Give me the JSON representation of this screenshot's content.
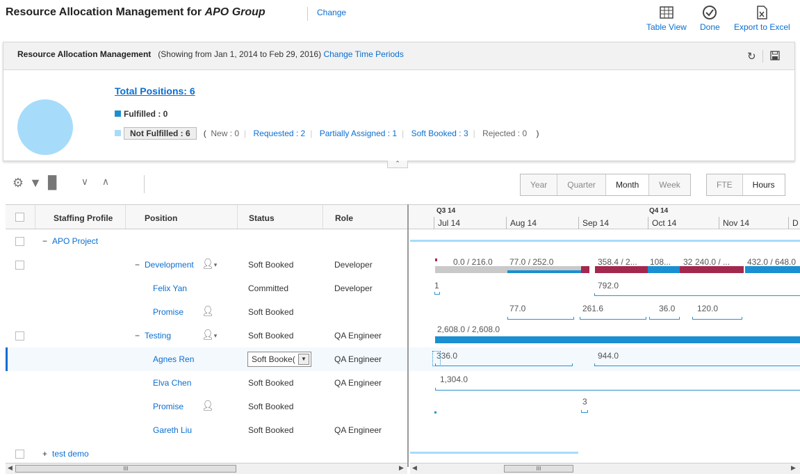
{
  "header": {
    "title_prefix": "Resource Allocation Management for",
    "group": "APO Group",
    "change": "Change",
    "table_view": "Table View",
    "done": "Done",
    "export": "Export to Excel"
  },
  "panel": {
    "title": "Resource Allocation Management",
    "showing": "(Showing from Jan 1, 2014 to Feb 29, 2016)",
    "change_periods": "Change Time Periods",
    "total_positions": "Total Positions:  6",
    "fulfilled": "Fulfilled : 0",
    "not_fulfilled": "Not Fulfilled : 6",
    "open_paren": "(",
    "new": "New : 0",
    "requested": "Requested : 2",
    "partially": "Partially Assigned : 1",
    "soft_booked": "Soft Booked : 3",
    "rejected": "Rejected : 0",
    "close_paren": ")",
    "colors": {
      "fulfilled": "#1a8fd1",
      "not_fulfilled": "#a6dcfa"
    }
  },
  "timescale": {
    "options": [
      "Year",
      "Quarter",
      "Month",
      "Week"
    ],
    "selected": "Month"
  },
  "unit": {
    "options": [
      "FTE",
      "Hours"
    ],
    "selected": "Hours"
  },
  "columns": {
    "profile": "Staffing Profile",
    "position": "Position",
    "status": "Status",
    "role": "Role"
  },
  "rows": {
    "apo": {
      "expander": "−",
      "label": "APO Project"
    },
    "dev": {
      "expander": "−",
      "position": "Development",
      "status": "Soft Booked",
      "role": "Developer"
    },
    "felix": {
      "position": "Felix Yan",
      "status": "Committed",
      "role": "Developer"
    },
    "promise1": {
      "position": "Promise",
      "status": "Soft Booked",
      "role": ""
    },
    "testing": {
      "expander": "−",
      "position": "Testing",
      "status": "Soft Booked",
      "role": "QA Engineer"
    },
    "agnes": {
      "position": "Agnes Ren",
      "status": "Soft Booke(",
      "role": "QA Engineer"
    },
    "elva": {
      "position": "Elva Chen",
      "status": "Soft Booked",
      "role": "QA Engineer"
    },
    "promise2": {
      "position": "Promise",
      "status": "Soft Booked",
      "role": ""
    },
    "gareth": {
      "position": "Gareth Liu",
      "status": "Soft Booked",
      "role": "QA Engineer"
    },
    "demo": {
      "expander": "+",
      "label": "test demo"
    }
  },
  "gantt": {
    "quarters": [
      "Q3 14",
      "Q4 14"
    ],
    "months": [
      "Jul 14",
      "Aug 14",
      "Sep 14",
      "Oct 14",
      "Nov 14",
      "D"
    ],
    "dev_vals": [
      "0.0 / 216.0",
      "77.0 / 252.0",
      "358.4 / 2...",
      "108...",
      "32",
      "240.0 / ...",
      "432.0 / 648.0"
    ],
    "felix_vals": [
      "1",
      "792.0"
    ],
    "promise1_vals": [
      "77.0",
      "261.6",
      "36.0",
      "120.0"
    ],
    "testing_vals": [
      "2,608.0 / 2,608.0"
    ],
    "agnes_vals": [
      "336.0",
      "944.0"
    ],
    "elva_vals": [
      "1,304.0"
    ],
    "promise2_vals": [
      "3"
    ],
    "colors": {
      "assigned": "#1a8fd1",
      "over": "#a3284e",
      "open": "#c9c9c9",
      "bracket": "#2a91d2"
    }
  },
  "scroll": {
    "grip": "III"
  }
}
